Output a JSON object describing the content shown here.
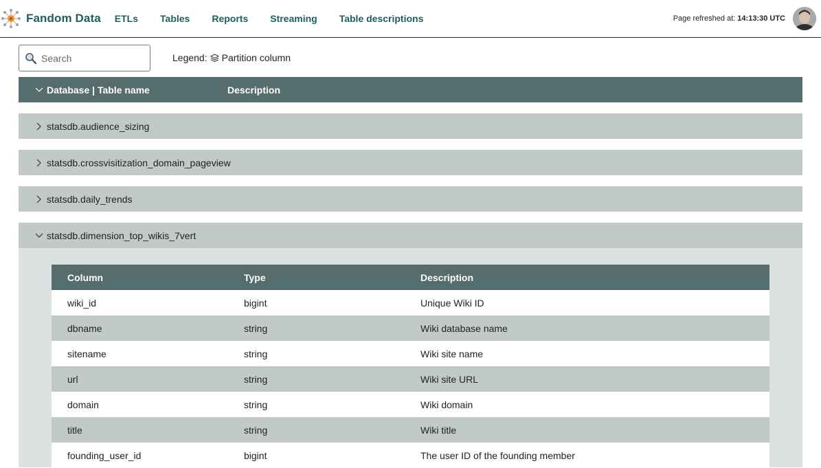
{
  "header": {
    "brand": "Fandom Data",
    "nav": [
      "ETLs",
      "Tables",
      "Reports",
      "Streaming",
      "Table descriptions"
    ],
    "refresh_label": "Page refreshed at:",
    "refresh_time": "14:13:30 UTC"
  },
  "search": {
    "placeholder": "Search"
  },
  "legend": {
    "label": "Legend:",
    "item": "Partition column"
  },
  "main_table": {
    "headers": {
      "name": "Database | Table name",
      "description": "Description"
    },
    "rows": [
      "statsdb.audience_sizing",
      "statsdb.crossvisitization_domain_pageview",
      "statsdb.daily_trends",
      "statsdb.dimension_top_wikis_7vert"
    ]
  },
  "columns_table": {
    "headers": {
      "column": "Column",
      "type": "Type",
      "description": "Description"
    },
    "rows": [
      {
        "column": "wiki_id",
        "type": "bigint",
        "description": "Unique Wiki ID"
      },
      {
        "column": "dbname",
        "type": "string",
        "description": "Wiki database name"
      },
      {
        "column": "sitename",
        "type": "string",
        "description": "Wiki site name"
      },
      {
        "column": "url",
        "type": "string",
        "description": "Wiki site URL"
      },
      {
        "column": "domain",
        "type": "string",
        "description": "Wiki domain"
      },
      {
        "column": "title",
        "type": "string",
        "description": "Wiki title"
      },
      {
        "column": "founding_user_id",
        "type": "bigint",
        "description": "The user ID of the founding member"
      }
    ]
  },
  "colors": {
    "brand": "#1d5e5e",
    "header_bg": "#566d6d",
    "row_bg": "#c2c9c9",
    "expanded_bg": "#dbe2e1"
  }
}
